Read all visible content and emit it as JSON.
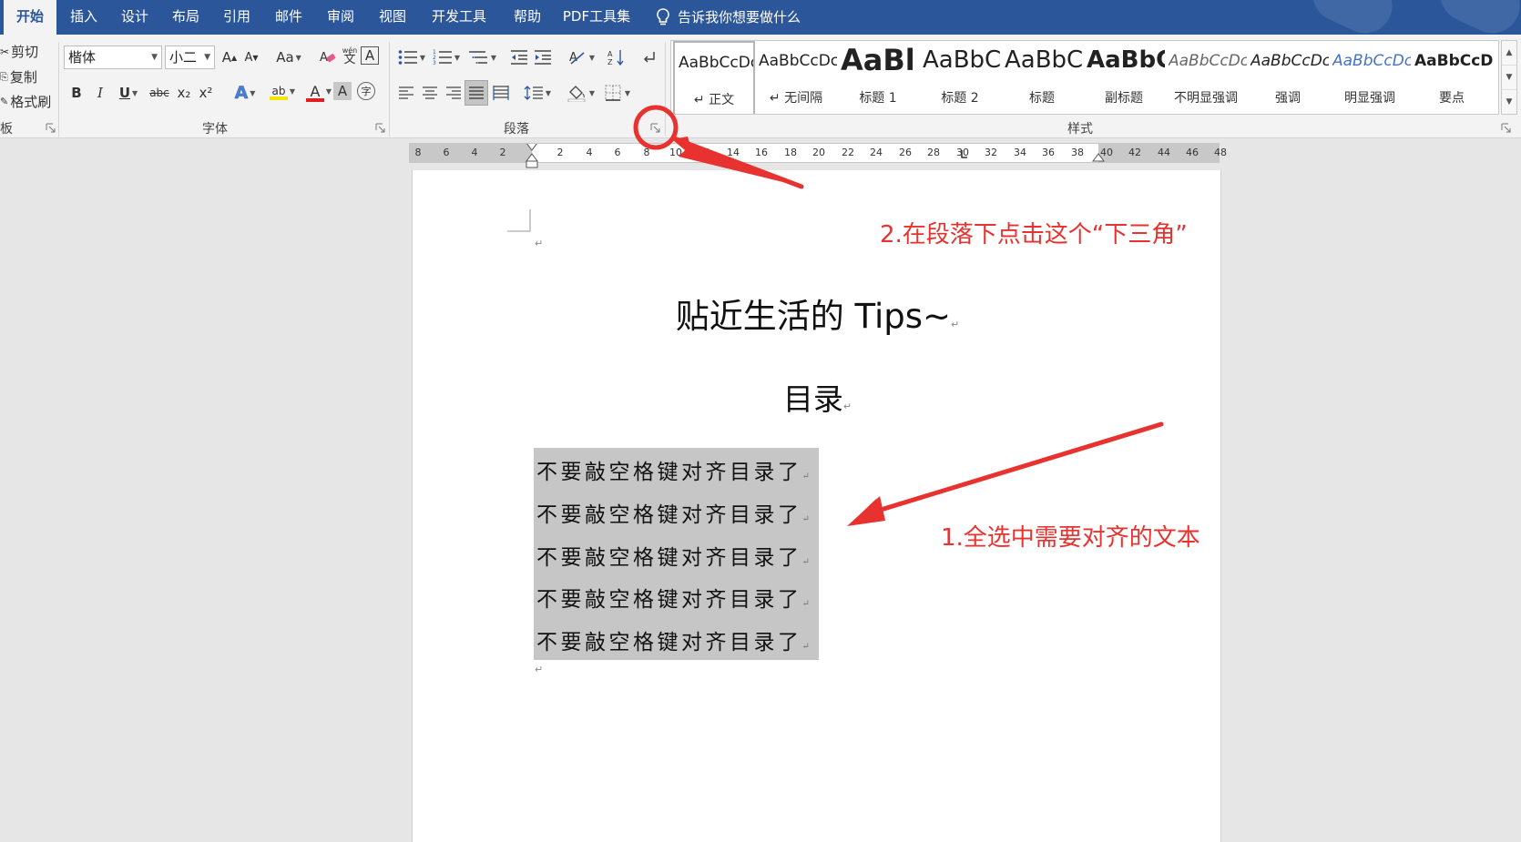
{
  "tabs": [
    {
      "label": "开始",
      "active": true
    },
    {
      "label": "插入"
    },
    {
      "label": "设计"
    },
    {
      "label": "布局"
    },
    {
      "label": "引用"
    },
    {
      "label": "邮件"
    },
    {
      "label": "审阅"
    },
    {
      "label": "视图"
    },
    {
      "label": "开发工具"
    },
    {
      "label": "帮助"
    },
    {
      "label": "PDF工具集"
    }
  ],
  "tell_me": "告诉我你想要做什么",
  "clipboard": {
    "cut": "剪切",
    "copy": "复制",
    "format_painter": "格式刷",
    "group_label": "板"
  },
  "font": {
    "name": "楷体",
    "size": "小二",
    "group_label": "字体",
    "grow": "A",
    "shrink": "A",
    "case": "Aa",
    "bold": "B",
    "italic": "I",
    "underline": "U",
    "strike": "abc",
    "sub": "x₂",
    "sup": "x²",
    "text_effect": "A",
    "highlight": "ab",
    "font_color": "A",
    "char_shading": "A",
    "phonetic": "wén",
    "char_border": "A",
    "enclose": "字"
  },
  "paragraph": {
    "group_label": "段落"
  },
  "styles": {
    "group_label": "样式",
    "items": [
      {
        "sample": "AaBbCcDc",
        "name": "↵ 正文"
      },
      {
        "sample": "AaBbCcDc",
        "name": "↵ 无间隔"
      },
      {
        "sample": "AaBl",
        "name": "标题 1"
      },
      {
        "sample": "AaBbC",
        "name": "标题 2"
      },
      {
        "sample": "AaBbC",
        "name": "标题"
      },
      {
        "sample": "AaBbC",
        "name": "副标题"
      },
      {
        "sample": "AaBbCcDc",
        "name": "不明显强调"
      },
      {
        "sample": "AaBbCcDc",
        "name": "强调"
      },
      {
        "sample": "AaBbCcDc",
        "name": "明显强调"
      },
      {
        "sample": "AaBbCcD",
        "name": "要点"
      }
    ]
  },
  "ruler": {
    "numbers": [
      "8",
      "6",
      "4",
      "2",
      "2",
      "4",
      "6",
      "8",
      "10",
      "12",
      "14",
      "16",
      "18",
      "20",
      "22",
      "24",
      "26",
      "28",
      "30",
      "32",
      "34",
      "36",
      "38",
      "40",
      "42",
      "44",
      "46",
      "48"
    ]
  },
  "document": {
    "title": "贴近生活的 Tips~",
    "toc_heading": "目录",
    "toc_lines": [
      "不要敲空格键对齐目录了",
      "不要敲空格键对齐目录了",
      "不要敲空格键对齐目录了",
      "不要敲空格键对齐目录了",
      "不要敲空格键对齐目录了"
    ],
    "paragraph_mark": "↵"
  },
  "annotations": {
    "step1": "1.全选中需要对齐的文本",
    "step2": "2.在段落下点击这个“下三角”",
    "color": "#e8322f"
  },
  "colors": {
    "accent": "#2b579a",
    "ribbon": "#f3f3f3",
    "selection": "#c6c6c6"
  }
}
